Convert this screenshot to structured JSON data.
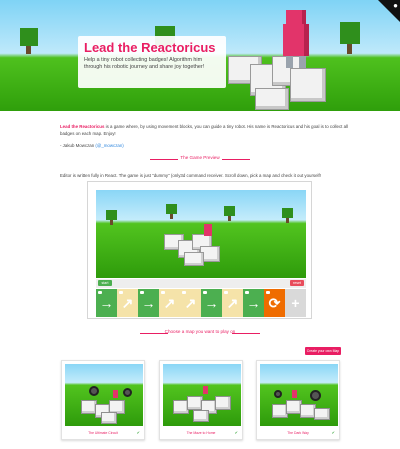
{
  "hero": {
    "title": "Lead the Reactoricus",
    "subtitle": "Help a tiny robot collecting badges! Algorithm him through his robotic journey and share joy together!"
  },
  "intro": {
    "name": "Lead the Reactoricus",
    "text": " is a game where, by using movement blocks, you can guide a tiny robot. His name is Reactoricus and his goal is to collect all badges on each map. Enjoy!",
    "signature": "- Jakub Mowczan",
    "signature_link": "(@_mowczan)"
  },
  "preview": {
    "section_title": "The Game Preview",
    "note": "Editor is written fully in React. The game is just \"dummy\" (only3d command receiver. Scroll down, pick a map and check it out yourself!"
  },
  "editor": {
    "start_label": "start",
    "reset_label": "reset",
    "commands": [
      {
        "kind": "green",
        "symbol": "→"
      },
      {
        "kind": "cream",
        "symbol": "↗"
      },
      {
        "kind": "green",
        "symbol": "→"
      },
      {
        "kind": "cream",
        "symbol": "↗"
      },
      {
        "kind": "cream",
        "symbol": "↗"
      },
      {
        "kind": "green",
        "symbol": "→"
      },
      {
        "kind": "cream",
        "symbol": "↗"
      },
      {
        "kind": "green",
        "symbol": "→"
      },
      {
        "kind": "orange",
        "symbol": "⟳"
      },
      {
        "kind": "grey",
        "symbol": "+"
      }
    ]
  },
  "maps": {
    "section_title": "Choose a map you want to play on",
    "create_label": "Create your own Map",
    "items": [
      {
        "name": "The Ultimate Circuit",
        "check": "✔"
      },
      {
        "name": "The Maze to Home",
        "check": "✔"
      },
      {
        "name": "The Dark Way",
        "check": "✔"
      }
    ]
  },
  "icons": {
    "corner": "github-icon"
  },
  "colors": {
    "accent": "#e91e63",
    "robot": "#e2346a",
    "grass": "#4fc11e",
    "sky": "#8ad6f6"
  }
}
